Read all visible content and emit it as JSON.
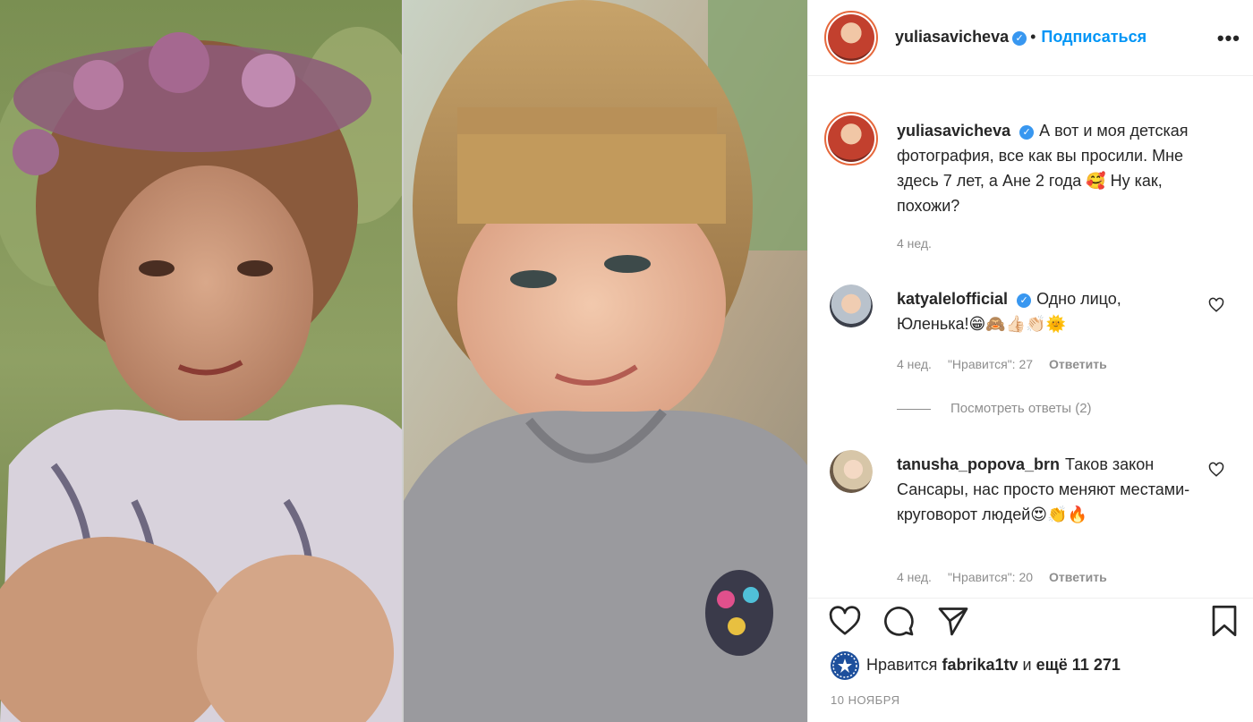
{
  "post": {
    "author": "yuliasavicheva",
    "follow_label": "Подписаться",
    "more_label": "•••",
    "dot": "•"
  },
  "caption": {
    "username": "yuliasavicheva",
    "text": "А вот и моя детская фотография, все как вы просили. Мне здесь 7 лет, а Ане 2 года 🥰 Ну как, похожи?",
    "time": "4 нед."
  },
  "comments": [
    {
      "username": "katyalelofficial",
      "text": "Одно лицо, Юленька!😁🙈👍🏻👏🏻🌞",
      "time": "4 нед.",
      "likes": "\"Нравится\": 27",
      "reply": "Ответить"
    },
    {
      "username": "tanusha_popova_brn",
      "text": "Таков закон Сансары, нас просто меняют местами-круговорот людей😍👏🔥",
      "time": "4 нед.",
      "likes": "\"Нравится\": 20",
      "reply": "Ответить"
    }
  ],
  "view_replies": "Посмотреть ответы (2)",
  "likes": {
    "prefix": "Нравится",
    "user": "fabrika1tv",
    "connector": "и",
    "count": "ещё 11 271"
  },
  "date": "10 НОЯБРЯ",
  "icons": {
    "like": "heart-icon",
    "comment": "comment-icon",
    "share": "paper-plane-icon",
    "save": "bookmark-icon",
    "verified": "verified-badge-icon"
  },
  "colors": {
    "link": "#0095f6",
    "verified": "#3897f0",
    "muted": "#8e8e8e",
    "text": "#262626"
  }
}
